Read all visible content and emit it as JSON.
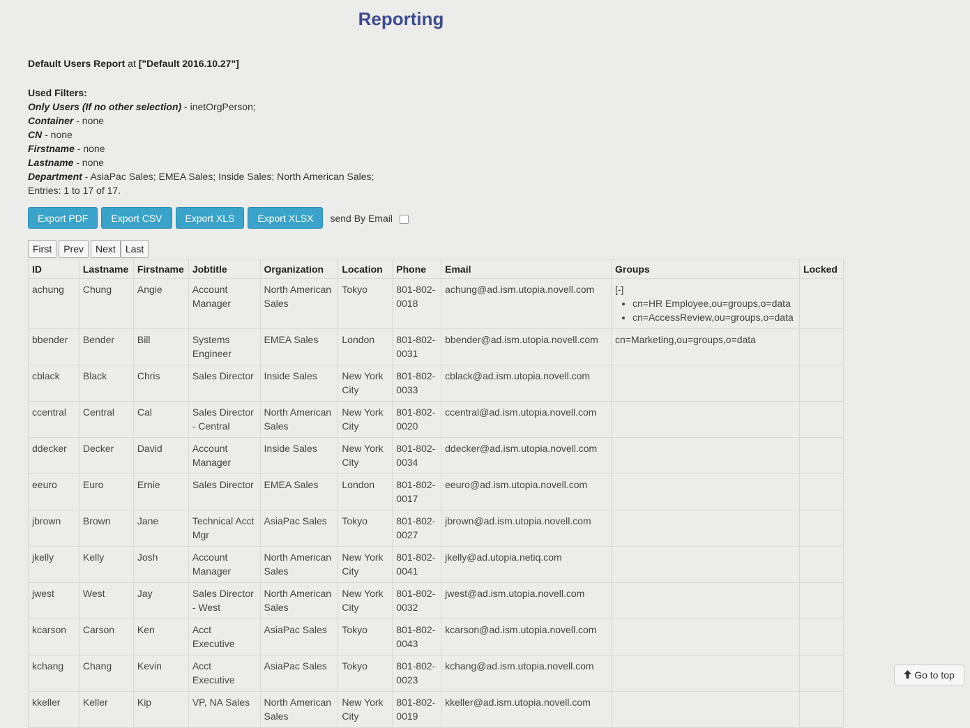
{
  "page": {
    "title": "Reporting"
  },
  "report": {
    "name": "Default Users Report",
    "at_word": "at",
    "profile": "[\"Default 2016.10.27\"]"
  },
  "filters": {
    "heading": "Used Filters:",
    "items": [
      {
        "label": "Only Users (If no other selection)",
        "value": " - inetOrgPerson;"
      },
      {
        "label": "Container",
        "value": " - none"
      },
      {
        "label": "CN",
        "value": " - none"
      },
      {
        "label": "Firstname",
        "value": " - none"
      },
      {
        "label": "Lastname",
        "value": " - none"
      },
      {
        "label": "Department",
        "value": " - AsiaPac Sales; EMEA Sales; Inside Sales; North American Sales;"
      }
    ],
    "entries": "Entries: 1 to 17 of 17."
  },
  "export": {
    "pdf": "Export PDF",
    "csv": "Export CSV",
    "xls": "Export XLS",
    "xlsx": "Export XLSX",
    "email_label": "send By Email"
  },
  "pager": {
    "first": "First",
    "prev": "Prev",
    "next": "Next",
    "last": "Last"
  },
  "table": {
    "headers": [
      "ID",
      "Lastname",
      "Firstname",
      "Jobtitle",
      "Organization",
      "Location",
      "Phone",
      "Email",
      "Groups",
      "Locked"
    ],
    "rows": [
      {
        "id": "achung",
        "last": "Chung",
        "first": "Angie",
        "job": "Account Manager",
        "org": "North American Sales",
        "loc": "Tokyo",
        "phone": "801-802-0018",
        "email": "achung@ad.ism.utopia.novell.com",
        "groups_toggle": "[-]",
        "groups_list": [
          "cn=HR Employee,ou=groups,o=data",
          "cn=AccessReview,ou=groups,o=data"
        ],
        "groups": "",
        "locked": ""
      },
      {
        "id": "bbender",
        "last": "Bender",
        "first": "Bill",
        "job": "Systems Engineer",
        "org": "EMEA Sales",
        "loc": "London",
        "phone": "801-802-0031",
        "email": "bbender@ad.ism.utopia.novell.com",
        "groups": "cn=Marketing,ou=groups,o=data",
        "locked": ""
      },
      {
        "id": "cblack",
        "last": "Black",
        "first": "Chris",
        "job": "Sales Director",
        "org": "Inside Sales",
        "loc": "New York City",
        "phone": "801-802-0033",
        "email": "cblack@ad.ism.utopia.novell.com",
        "groups": "",
        "locked": ""
      },
      {
        "id": "ccentral",
        "last": "Central",
        "first": "Cal",
        "job": "Sales Director - Central",
        "org": "North American Sales",
        "loc": "New York City",
        "phone": "801-802-0020",
        "email": "ccentral@ad.ism.utopia.novell.com",
        "groups": "",
        "locked": ""
      },
      {
        "id": "ddecker",
        "last": "Decker",
        "first": "David",
        "job": "Account Manager",
        "org": "Inside Sales",
        "loc": "New York City",
        "phone": "801-802-0034",
        "email": "ddecker@ad.ism.utopia.novell.com",
        "groups": "",
        "locked": ""
      },
      {
        "id": "eeuro",
        "last": "Euro",
        "first": "Ernie",
        "job": "Sales Director",
        "org": "EMEA Sales",
        "loc": "London",
        "phone": "801-802-0017",
        "email": "eeuro@ad.ism.utopia.novell.com",
        "groups": "",
        "locked": ""
      },
      {
        "id": "jbrown",
        "last": "Brown",
        "first": "Jane",
        "job": "Technical Acct Mgr",
        "org": "AsiaPac Sales",
        "loc": "Tokyo",
        "phone": "801-802-0027",
        "email": "jbrown@ad.ism.utopia.novell.com",
        "groups": "",
        "locked": ""
      },
      {
        "id": "jkelly",
        "last": "Kelly",
        "first": "Josh",
        "job": "Account Manager",
        "org": "North American Sales",
        "loc": "New York City",
        "phone": "801-802-0041",
        "email": "jkelly@ad.utopia.netiq.com",
        "groups": "",
        "locked": ""
      },
      {
        "id": "jwest",
        "last": "West",
        "first": "Jay",
        "job": "Sales Director - West",
        "org": "North American Sales",
        "loc": "New York City",
        "phone": "801-802-0032",
        "email": "jwest@ad.ism.utopia.novell.com",
        "groups": "",
        "locked": ""
      },
      {
        "id": "kcarson",
        "last": "Carson",
        "first": "Ken",
        "job": "Acct Executive",
        "org": "AsiaPac Sales",
        "loc": "Tokyo",
        "phone": "801-802-0043",
        "email": "kcarson@ad.ism.utopia.novell.com",
        "groups": "",
        "locked": ""
      },
      {
        "id": "kchang",
        "last": "Chang",
        "first": "Kevin",
        "job": "Acct Executive",
        "org": "AsiaPac Sales",
        "loc": "Tokyo",
        "phone": "801-802-0023",
        "email": "kchang@ad.ism.utopia.novell.com",
        "groups": "",
        "locked": ""
      },
      {
        "id": "kkeller",
        "last": "Keller",
        "first": "Kip",
        "job": "VP, NA Sales",
        "org": "North American Sales",
        "loc": "New York City",
        "phone": "801-802-0019",
        "email": "kkeller@ad.ism.utopia.novell.com",
        "groups": "",
        "locked": ""
      }
    ]
  },
  "go_top": {
    "label": "Go to top",
    "icon": "arrow-up-icon"
  }
}
